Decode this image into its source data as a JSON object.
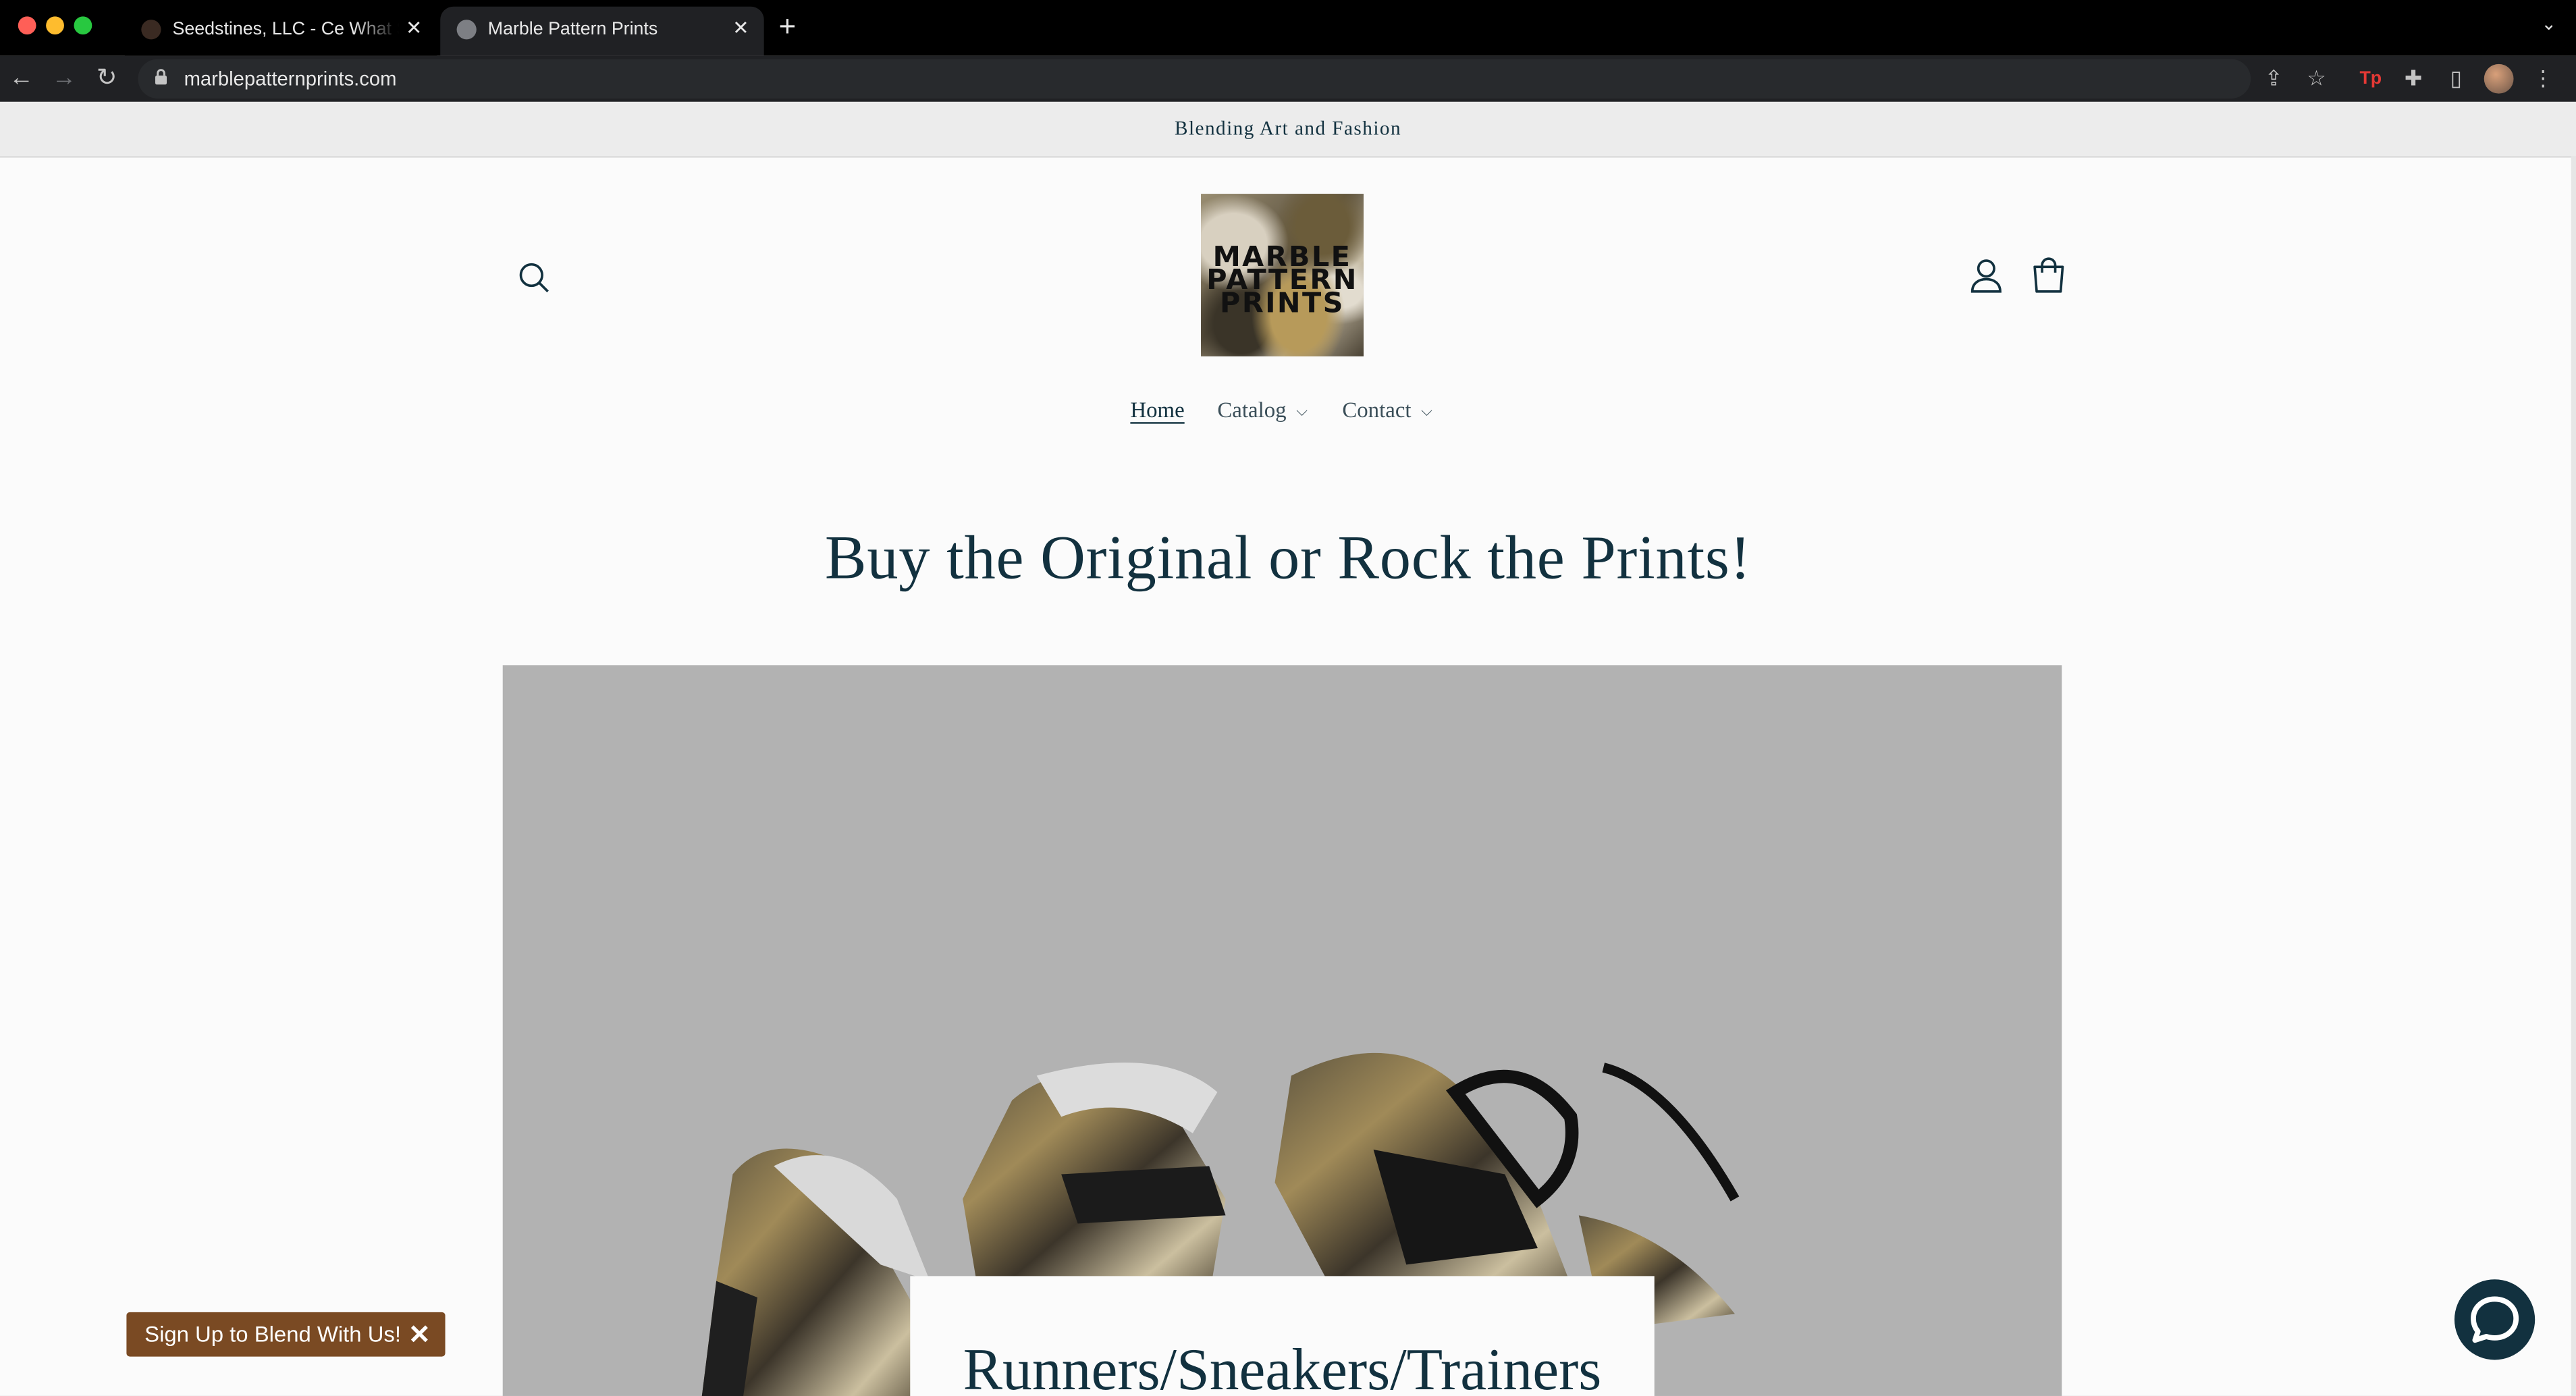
{
  "browser": {
    "tabs": [
      {
        "title": "Seedstines, LLC - Ce What She Sees",
        "active": false
      },
      {
        "title": "Marble Pattern Prints",
        "active": true
      }
    ],
    "new_tab_icon": "plus-icon",
    "url": "marblepatternprints.com"
  },
  "site": {
    "announcement": "Blending Art and Fashion",
    "logo_text": [
      "MARBLE",
      "PATTERN",
      "PRINTS"
    ],
    "nav": [
      {
        "label": "Home",
        "current": true
      },
      {
        "label": "Catalog",
        "has_dropdown": true
      },
      {
        "label": "Contact",
        "has_dropdown": true
      }
    ],
    "headline": "Buy the Original or Rock the Prints!",
    "hero_caption": "Runners/Sneakers/Trainers",
    "signup_label": "Sign Up to Blend With Us!",
    "colors": {
      "brand_text": "#12313f",
      "signup_bg": "#7a4a23",
      "announcement_bg": "#ececec",
      "hero_bg": "#b2b2b2"
    }
  }
}
